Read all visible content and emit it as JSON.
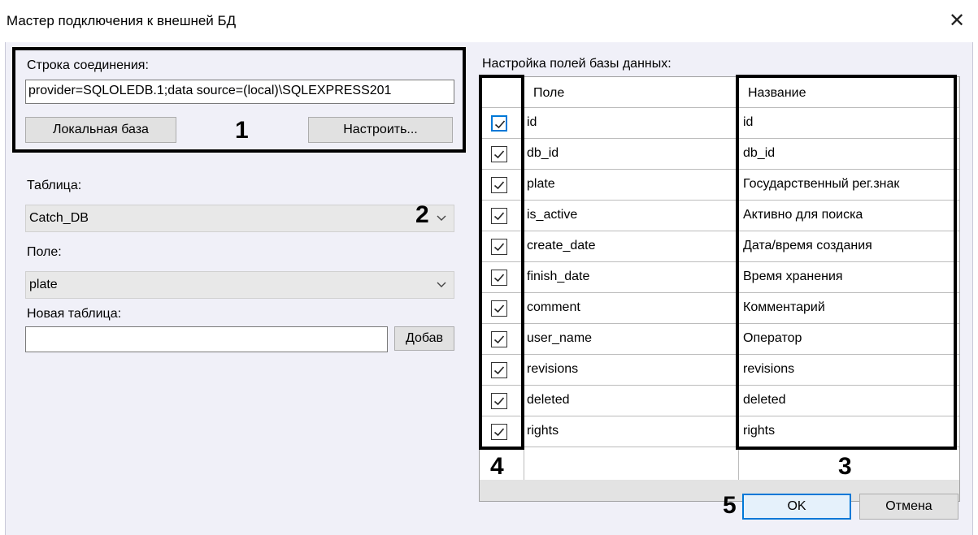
{
  "window": {
    "title": "Мастер подключения к внешней БД",
    "close_glyph": "✕"
  },
  "connection": {
    "label": "Строка соединения:",
    "value": "provider=SQLOLEDB.1;data source=(local)\\SQLEXPRESS201",
    "local_button": "Локальная база",
    "configure_button": "Настроить..."
  },
  "table": {
    "label": "Таблица:",
    "selected": "Catch_DB"
  },
  "field": {
    "label": "Поле:",
    "selected": "plate"
  },
  "new_table": {
    "label": "Новая таблица:",
    "value": "",
    "add_button": "Добав"
  },
  "grid": {
    "label": "Настройка полей базы данных:",
    "col_field": "Поле",
    "col_name": "Название",
    "rows": [
      {
        "field": "id",
        "name": "id",
        "checked": true
      },
      {
        "field": "db_id",
        "name": "db_id",
        "checked": true
      },
      {
        "field": "plate",
        "name": "Государственный рег.знак",
        "checked": true
      },
      {
        "field": "is_active",
        "name": "Активно для поиска",
        "checked": true
      },
      {
        "field": "create_date",
        "name": "Дата/время создания",
        "checked": true
      },
      {
        "field": "finish_date",
        "name": "Время хранения",
        "checked": true
      },
      {
        "field": "comment",
        "name": "Комментарий",
        "checked": true
      },
      {
        "field": "user_name",
        "name": "Оператор",
        "checked": true
      },
      {
        "field": "revisions",
        "name": "revisions",
        "checked": true
      },
      {
        "field": "deleted",
        "name": "deleted",
        "checked": true
      },
      {
        "field": "rights",
        "name": "rights",
        "checked": true
      }
    ]
  },
  "buttons": {
    "ok": "OK",
    "cancel": "Отмена"
  },
  "callouts": {
    "n1": "1",
    "n2": "2",
    "n3": "3",
    "n4": "4",
    "n5": "5"
  },
  "colors": {
    "accent": "#0078d7",
    "dialog_bg": "#f0f0f8"
  }
}
